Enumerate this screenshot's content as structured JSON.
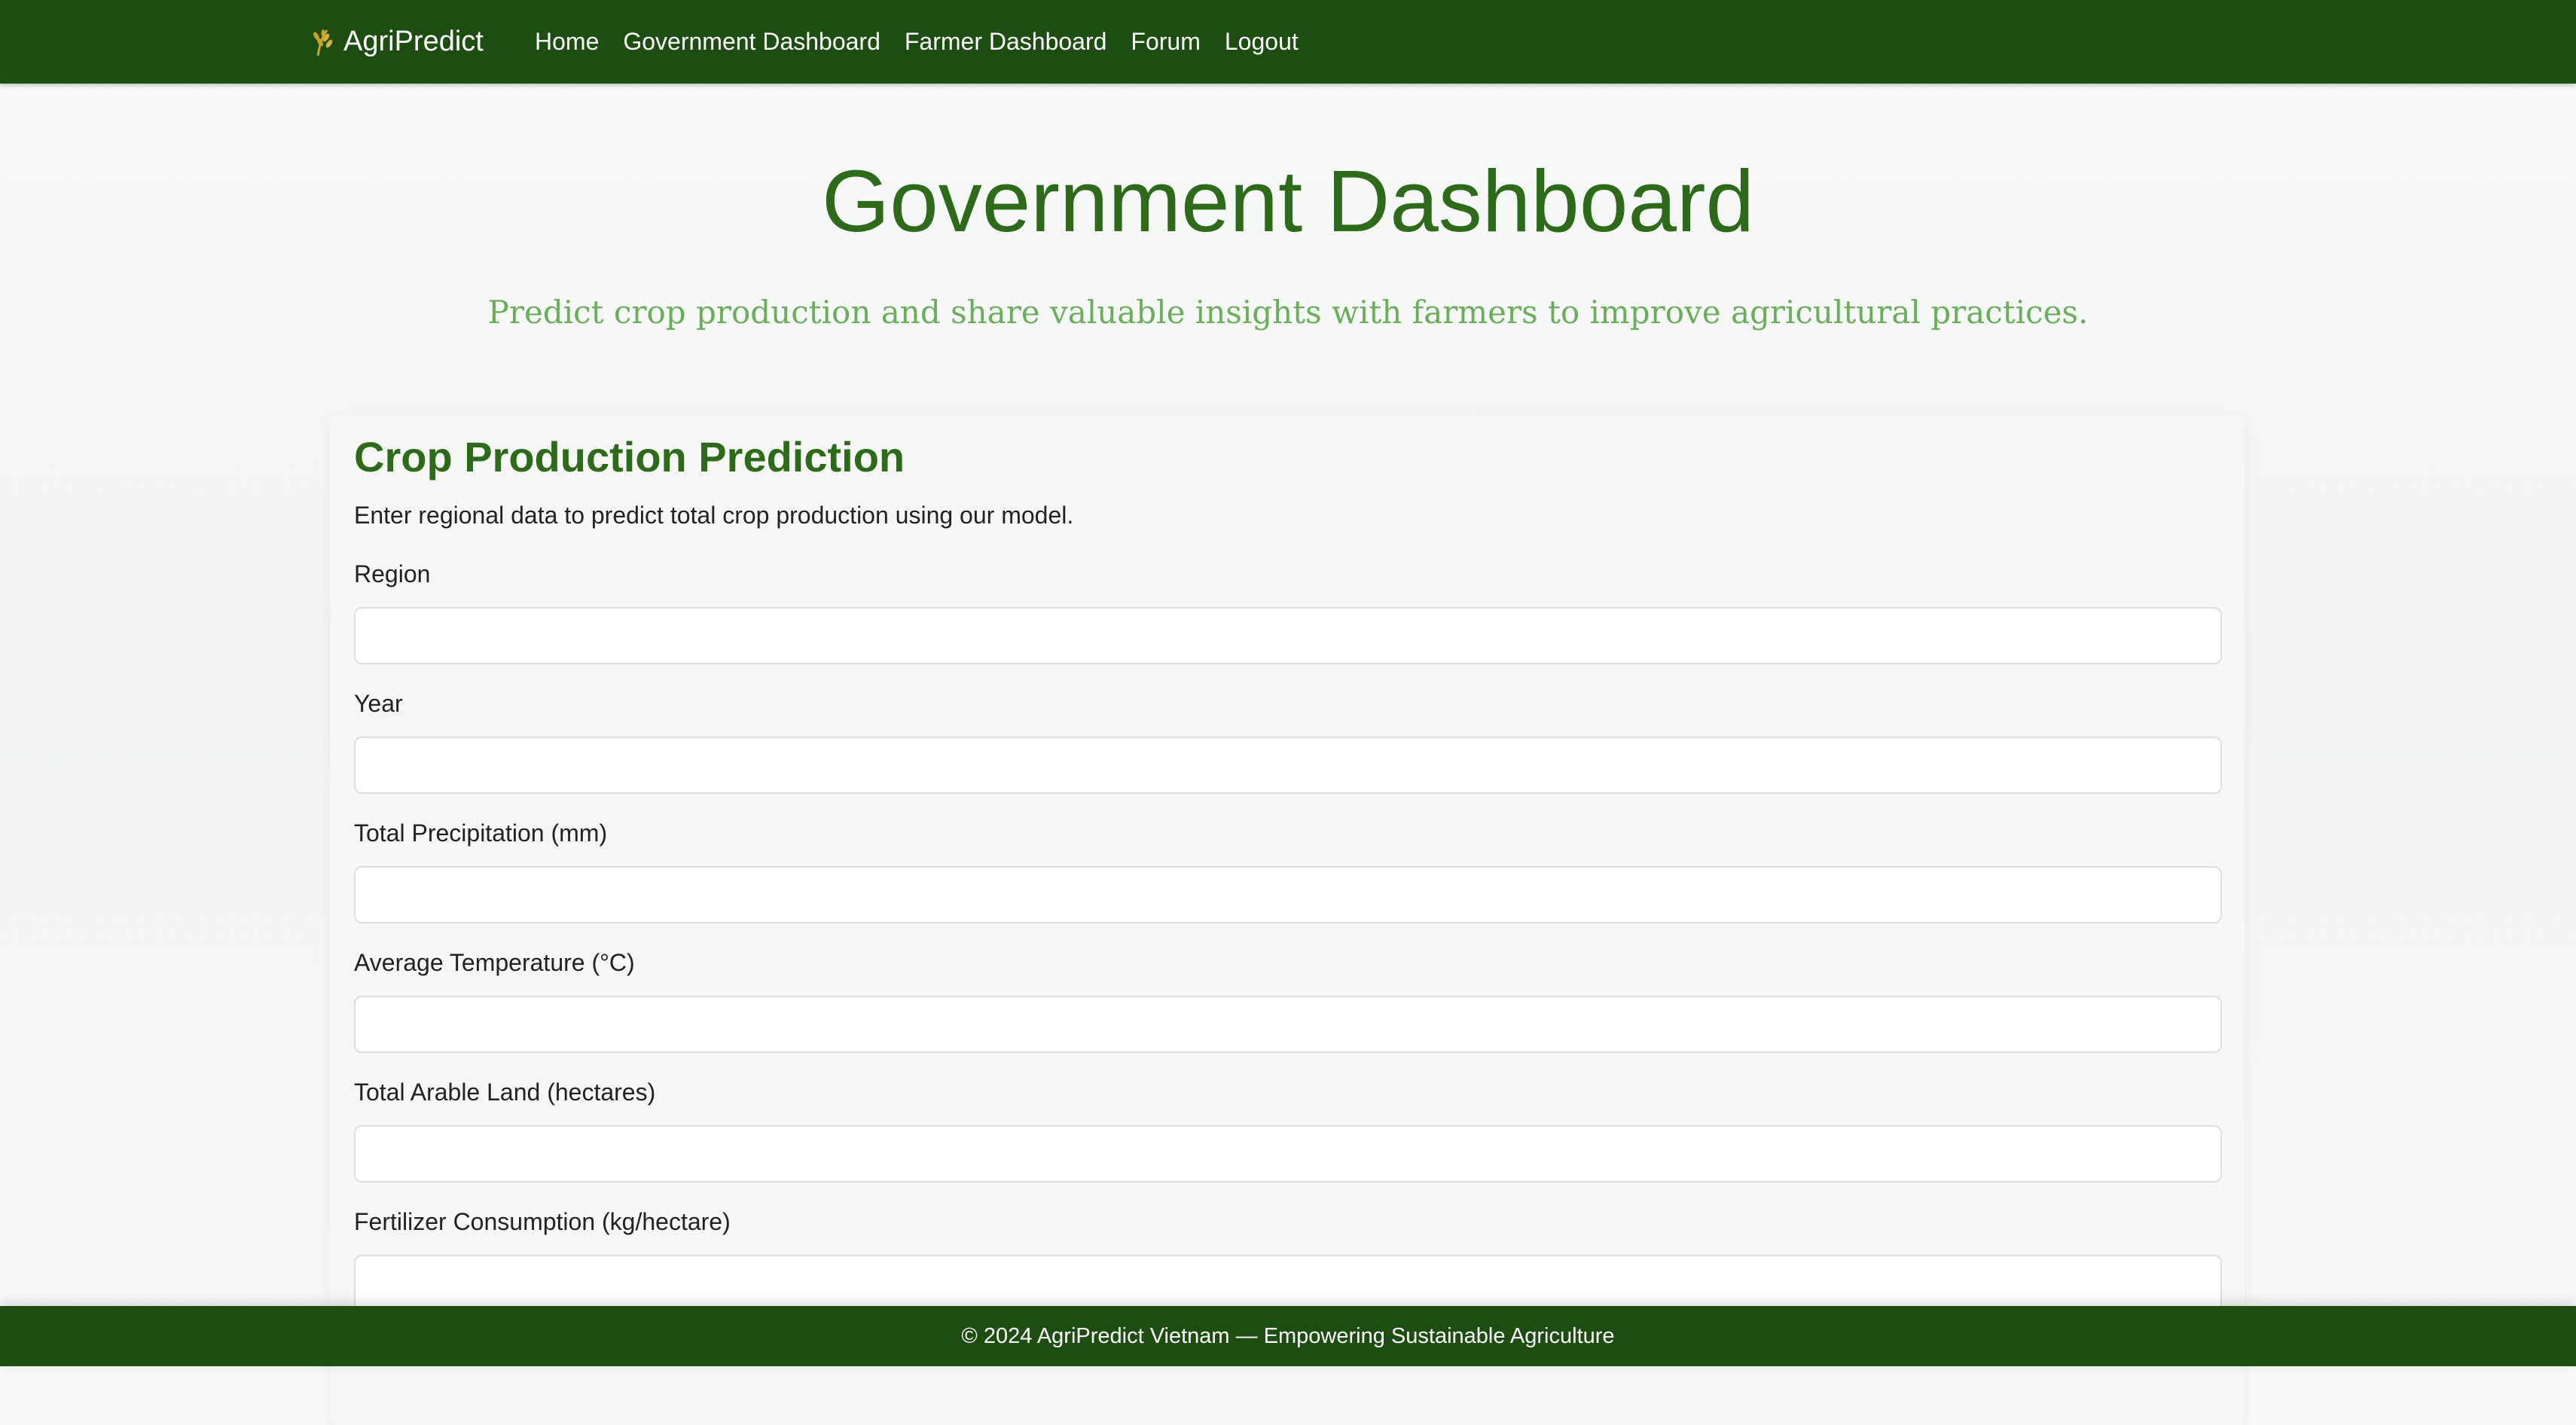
{
  "navbar": {
    "brand": {
      "icon": "wheat-icon",
      "name": "AgriPredict"
    },
    "links": [
      "Home",
      "Government Dashboard",
      "Farmer Dashboard",
      "Forum",
      "Logout"
    ]
  },
  "header": {
    "title": "Government Dashboard",
    "subtitle": "Predict crop production and share valuable insights with farmers to improve agricultural practices."
  },
  "form": {
    "title": "Crop Production Prediction",
    "description": "Enter regional data to predict total crop production using our model.",
    "fields": [
      {
        "label": "Region",
        "value": ""
      },
      {
        "label": "Year",
        "value": ""
      },
      {
        "label": "Total Precipitation (mm)",
        "value": ""
      },
      {
        "label": "Average Temperature (°C)",
        "value": ""
      },
      {
        "label": "Total Arable Land (hectares)",
        "value": ""
      },
      {
        "label": "Fertilizer Consumption (kg/hectare)",
        "value": ""
      }
    ]
  },
  "footer": {
    "text": "© 2024 AgriPredict Vietnam — Empowering Sustainable Agriculture"
  },
  "colors": {
    "nav_bg": "#1e4d12",
    "title": "#2d6a1a",
    "subtitle": "#6aae5c",
    "brand_icon": "#c9a227"
  }
}
